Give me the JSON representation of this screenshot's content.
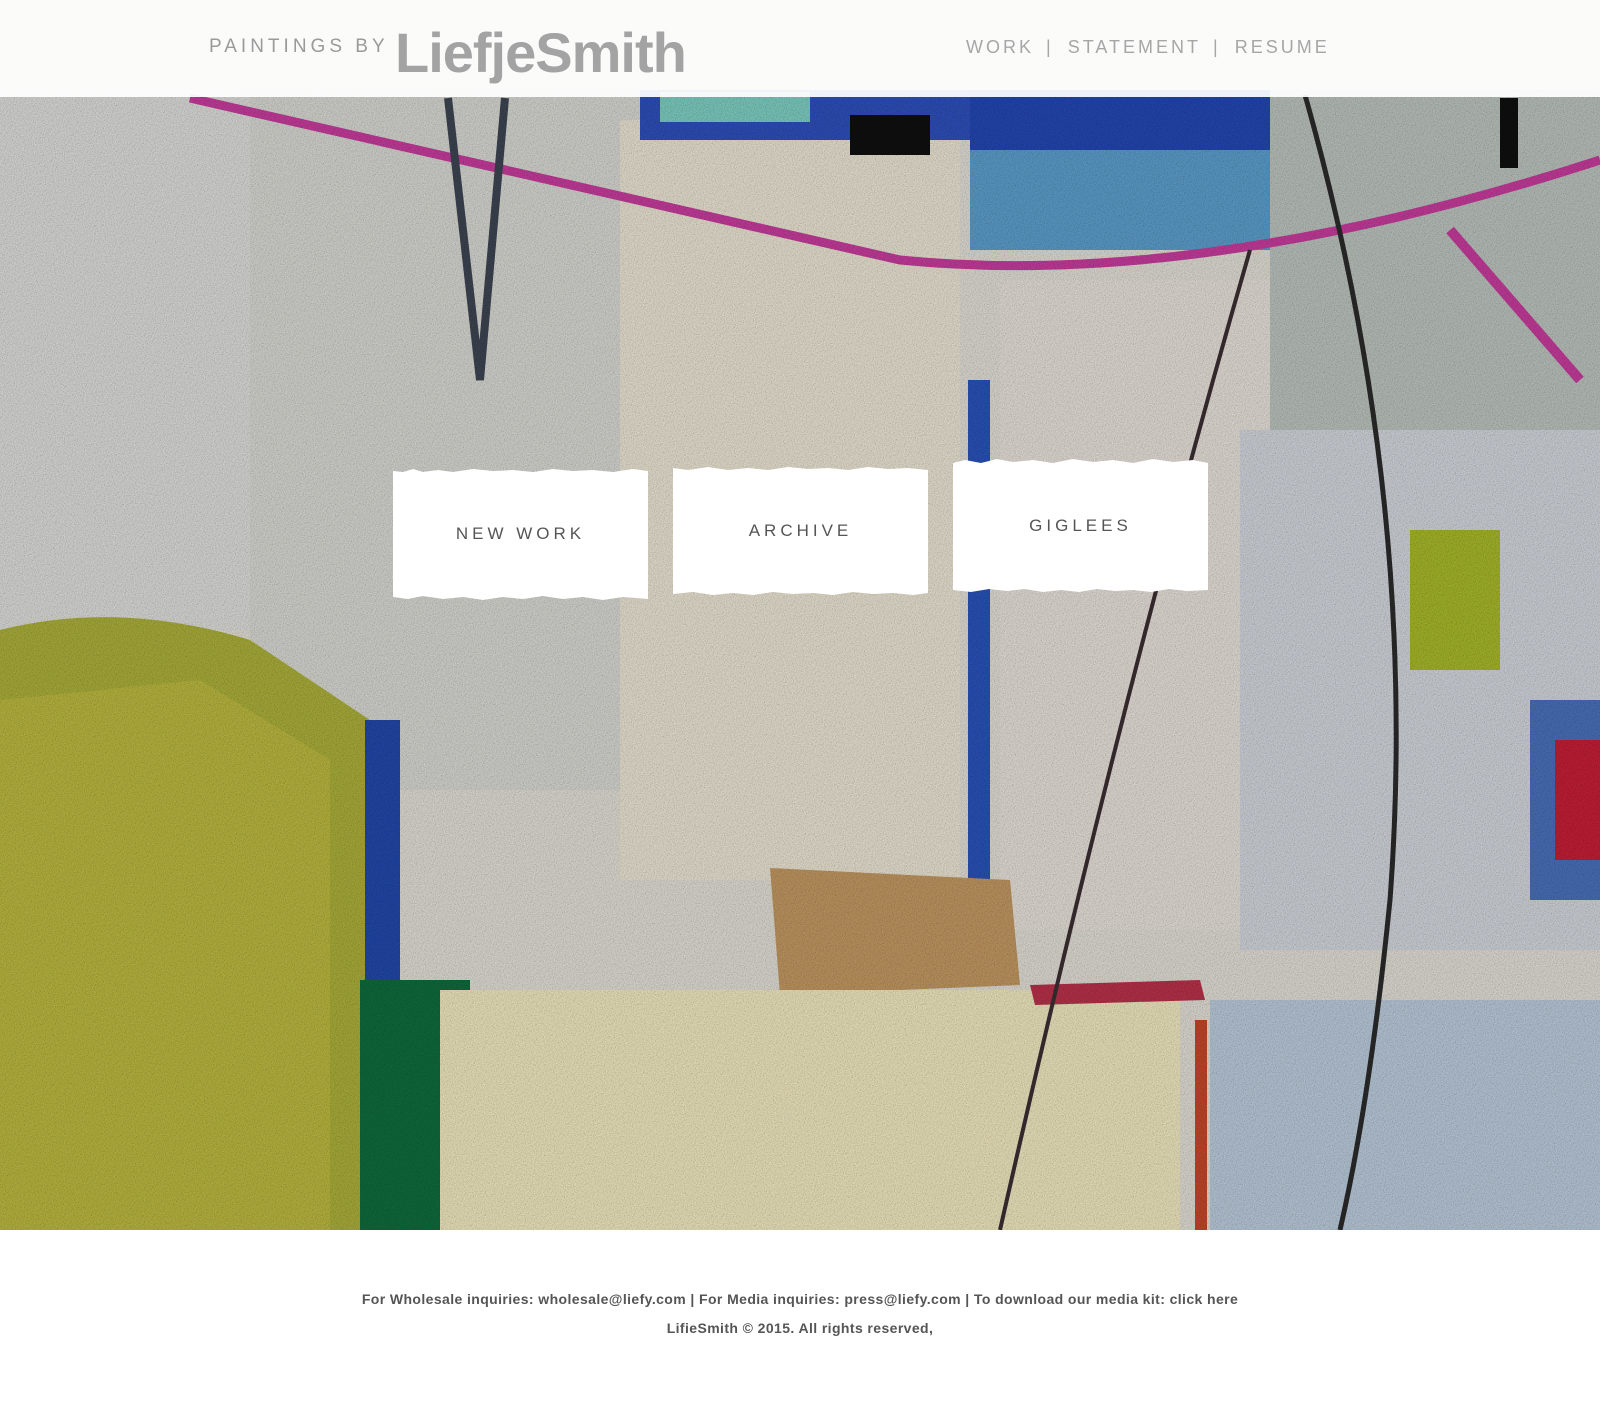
{
  "header": {
    "brand_prefix": "PAINTINGS BY",
    "brand_name": "LiefjeSmith",
    "nav": [
      {
        "label": "WORK"
      },
      {
        "label": "STATEMENT"
      },
      {
        "label": "RESUME"
      }
    ],
    "separator": "|"
  },
  "tiles": [
    {
      "label": "NEW WORK"
    },
    {
      "label": "ARCHIVE"
    },
    {
      "label": "GIGLEES"
    }
  ],
  "footer": {
    "wholesale_text": "For Wholesale inquiries: wholesale@liefy.com",
    "media_text": "For Media inquiries: press@liefy.com",
    "kit_text": "To download our media kit: click here",
    "separator": "|",
    "copyright": "LifieSmith ©  2015.  All rights reserved,"
  },
  "colors": {
    "header_text": "#a3a3a3",
    "tile_text": "#555555",
    "footer_text": "#555555"
  }
}
